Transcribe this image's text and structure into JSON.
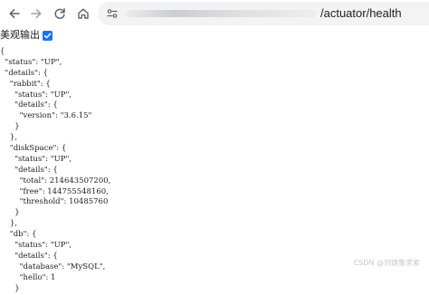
{
  "browser": {
    "url_path": "/actuator/health"
  },
  "pretty_print": {
    "label": "美观输出",
    "checked": true
  },
  "json_lines": [
    "{",
    "  \"status\": \"UP\",",
    "  \"details\": {",
    "    \"rabbit\": {",
    "      \"status\": \"UP\",",
    "      \"details\": {",
    "        \"version\": \"3.6.15\"",
    "      }",
    "    },",
    "    \"diskSpace\": {",
    "      \"status\": \"UP\",",
    "      \"details\": {",
    "        \"total\": 214643507200,",
    "        \"free\": 144755548160,",
    "        \"threshold\": 10485760",
    "      }",
    "    },",
    "    \"db\": {",
    "      \"status\": \"UP\",",
    "      \"details\": {",
    "        \"database\": \"MySQL\",",
    "        \"hello\": 1",
    "      }"
  ],
  "watermark": "CSDN @刘焕鲁求索"
}
